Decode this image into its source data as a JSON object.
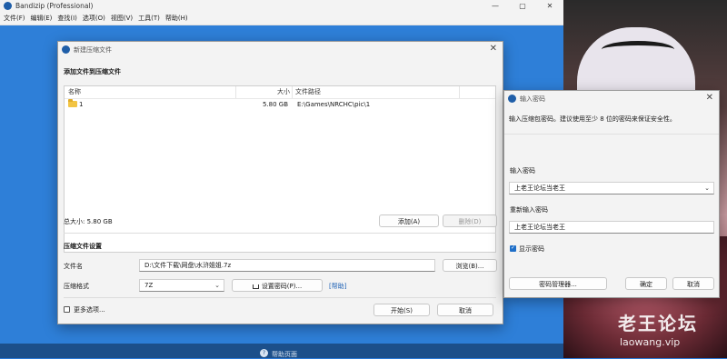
{
  "main_window": {
    "title": "Bandizip (Professional)",
    "controls": [
      "—",
      "▢",
      "✕"
    ],
    "menu": [
      "文件(F)",
      "编辑(E)",
      "查找(I)",
      "选项(O)",
      "视图(V)",
      "工具(T)",
      "帮助(H)"
    ],
    "status_link": "帮助页面"
  },
  "new_archive_dialog": {
    "title": "新建压缩文件",
    "section_add": "添加文件到压缩文件",
    "columns": [
      "名称",
      "大小",
      "文件路径"
    ],
    "rows": [
      {
        "name": "1",
        "size": "5.80 GB",
        "path": "E:\\Games\\NRCHC\\pic\\1"
      }
    ],
    "total_size": "总大小: 5.80 GB",
    "add_button": "添加(A)",
    "remove_button": "删除(D)",
    "section_settings": "压缩文件设置",
    "filename_label": "文件名",
    "filename_value": "D:\\文件下载\\网盘\\水浒姐姐.7z",
    "browse_button": "浏览(B)...",
    "format_label": "压缩格式",
    "format_value": "7Z",
    "set_password_button": "设置密码(P)...",
    "help_link": "[帮助]",
    "more_options_label": "更多选项...",
    "start_button": "开始(S)",
    "cancel_button": "取消"
  },
  "password_dialog": {
    "title": "输入密码",
    "description": "输入压缩包密码。建议使用至少 8 位的密码来保证安全性。",
    "password_label": "输入密码",
    "password_value": "上老王论坛当老王",
    "reenter_label": "重新输入密码",
    "reenter_value": "上老王论坛当老王",
    "show_password_label": "显示密码",
    "show_password_checked": true,
    "manager_button": "密码管理器...",
    "ok_button": "确定",
    "cancel_button": "取消"
  },
  "watermark": {
    "line1": "老王论坛",
    "line2": "laowang.vip"
  },
  "colors": {
    "desktop_blue": "#2e7fd8",
    "accent": "#1f6fc8",
    "link": "#1a5fb4"
  }
}
